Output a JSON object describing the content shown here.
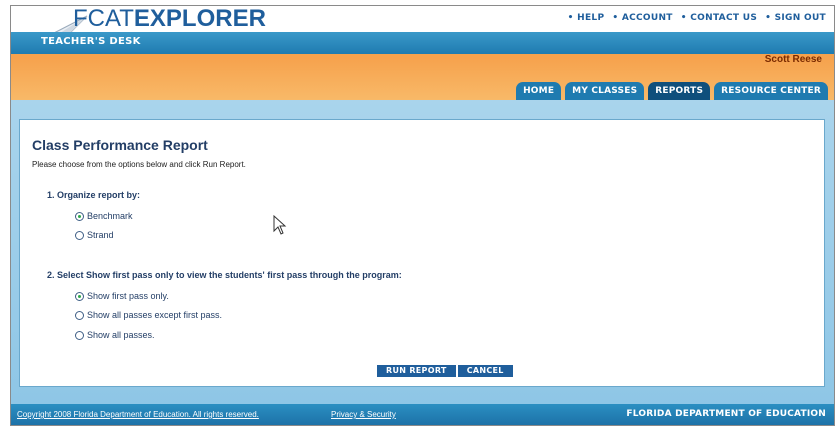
{
  "header": {
    "logo_prefix": "FCAT",
    "logo_suffix": "EXPLORER",
    "section": "TEACHER'S DESK",
    "user": "Scott Reese"
  },
  "util_links": [
    "• HELP",
    "• ACCOUNT",
    "• CONTACT US",
    "• SIGN OUT"
  ],
  "tabs": [
    {
      "label": "HOME",
      "active": false
    },
    {
      "label": "MY CLASSES",
      "active": false
    },
    {
      "label": "REPORTS",
      "active": true
    },
    {
      "label": "RESOURCE CENTER",
      "active": false
    }
  ],
  "report": {
    "title": "Class Performance Report",
    "intro": "Please choose from the options below and click Run Report.",
    "q1": {
      "label": "1.   Organize report by:",
      "options": [
        {
          "label": "Benchmark",
          "checked": true
        },
        {
          "label": "Strand",
          "checked": false
        }
      ]
    },
    "q2": {
      "label": "2.   Select Show first pass only to view the students' first pass through the program:",
      "options": [
        {
          "label": "Show first pass only.",
          "checked": true
        },
        {
          "label": "Show all passes except first pass.",
          "checked": false
        },
        {
          "label": "Show all passes.",
          "checked": false
        }
      ]
    },
    "run_label": "RUN REPORT",
    "cancel_label": "CANCEL"
  },
  "footer": {
    "copyright": "Copyright 2008 Florida Department of Education. All rights reserved.",
    "privacy": "Privacy & Security",
    "org": "FLORIDA DEPARTMENT OF EDUCATION"
  },
  "colors": {
    "brand_blue": "#1f5e9c",
    "orange": "#f6a24d",
    "teal": "#1f7bb0",
    "radio_check": "#2ea84a"
  }
}
